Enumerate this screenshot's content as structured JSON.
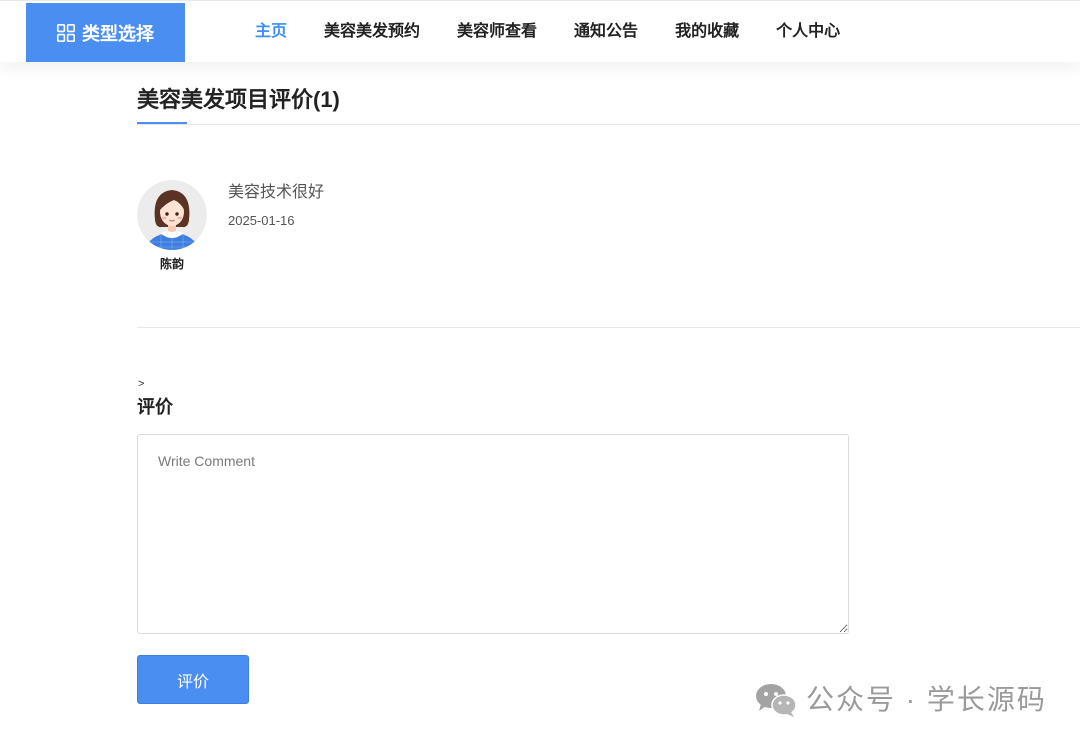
{
  "colors": {
    "accent": "#4a8ef2",
    "nav_active": "#3f8ef4"
  },
  "header": {
    "brand": {
      "label": "类型选择",
      "icon": "grid-icon"
    },
    "nav": [
      {
        "label": "主页",
        "active": true
      },
      {
        "label": "美容美发预约",
        "active": false
      },
      {
        "label": "美容师查看",
        "active": false
      },
      {
        "label": "通知公告",
        "active": false
      },
      {
        "label": "我的收藏",
        "active": false
      },
      {
        "label": "个人中心",
        "active": false
      }
    ]
  },
  "reviews": {
    "title": "美容美发项目评价(1)",
    "items": [
      {
        "avatar": "female-avatar-icon",
        "author": "陈韵",
        "text": "美容技术很好",
        "date": "2025-01-16"
      }
    ]
  },
  "comment_form": {
    "breadcrumb": ">",
    "heading": "评价",
    "placeholder": "Write Comment",
    "value": "",
    "submit_label": "评价"
  },
  "watermark": {
    "icon": "wechat-icon",
    "text": "公众号 · 学长源码"
  }
}
